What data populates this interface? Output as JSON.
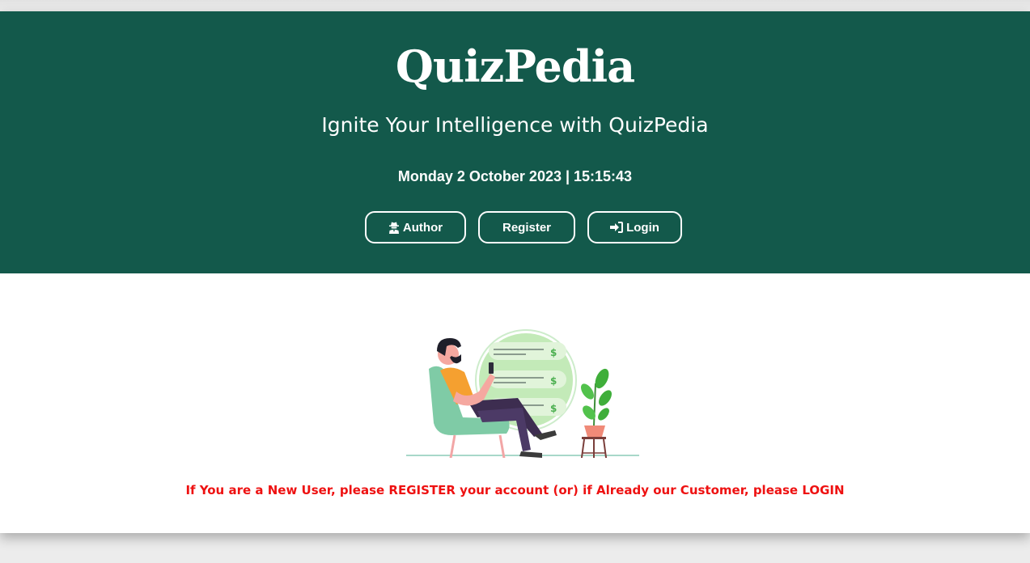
{
  "header": {
    "logo": "QuizPedia",
    "tagline": "Ignite Your Intelligence with QuizPedia",
    "datetime": "Monday 2 October 2023 | 15:15:43"
  },
  "nav": {
    "author": {
      "label": "Author",
      "icon": "user-secret-icon"
    },
    "register": {
      "label": "Register"
    },
    "login": {
      "label": "Login",
      "icon": "sign-in-icon"
    }
  },
  "main": {
    "notice": "If You are a New User, please REGISTER your account (or) if Already our Customer, please LOGIN"
  },
  "colors": {
    "brand": "#13594b",
    "notice": "#ee1111",
    "background": "#ececec"
  }
}
